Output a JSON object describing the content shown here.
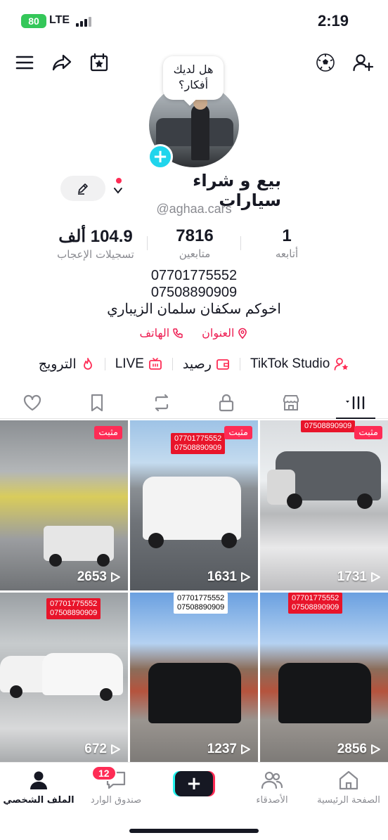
{
  "status_bar": {
    "battery": "80",
    "network": "LTE",
    "time": "2:19"
  },
  "profile": {
    "bubble_text": "هل لديك أفكار؟",
    "display_name": "بيع و شراء سيارات",
    "username": "@aghaa.cars",
    "stats": [
      {
        "value": "1",
        "label": "أتابعه"
      },
      {
        "value": "7816",
        "label": "متابعين"
      },
      {
        "value": "104.9 ألف",
        "label": "تسجيلات الإعجاب"
      }
    ],
    "bio": [
      "07701775552",
      "07508890909",
      "اخوكم سكفان سلمان الزيباري"
    ],
    "links": {
      "address": "العنوان",
      "phone": "الهاتف"
    }
  },
  "tools": {
    "studio": "TikTok Studio",
    "balance": "رصيد",
    "live": "LIVE",
    "promote": "الترويج"
  },
  "tabs": [
    "videos-grid",
    "shop",
    "private",
    "reposts",
    "favorites",
    "liked"
  ],
  "videos": [
    {
      "views": "1731",
      "pinned": "مثبت",
      "phones": "07508890909"
    },
    {
      "views": "1631",
      "pinned": "مثبت",
      "phones": "07701775552\n07508890909"
    },
    {
      "views": "2653",
      "pinned": "مثبت",
      "phones": ""
    },
    {
      "views": "2856",
      "pinned": "",
      "phones": "07701775552\n07508890909"
    },
    {
      "views": "1237",
      "pinned": "",
      "phones": "07701775552\n07508890909"
    },
    {
      "views": "672",
      "pinned": "",
      "phones": "07701775552\n07508890909"
    }
  ],
  "bottom_nav": {
    "home": "الصفحة الرئيسية",
    "friends": "الأصدقاء",
    "inbox": "صندوق الوارد",
    "inbox_badge": "12",
    "profile": "الملف الشخصي"
  },
  "colors": {
    "accent_red": "#fe2c55",
    "link_red": "#ee1d52",
    "cyan": "#20d5ec"
  }
}
